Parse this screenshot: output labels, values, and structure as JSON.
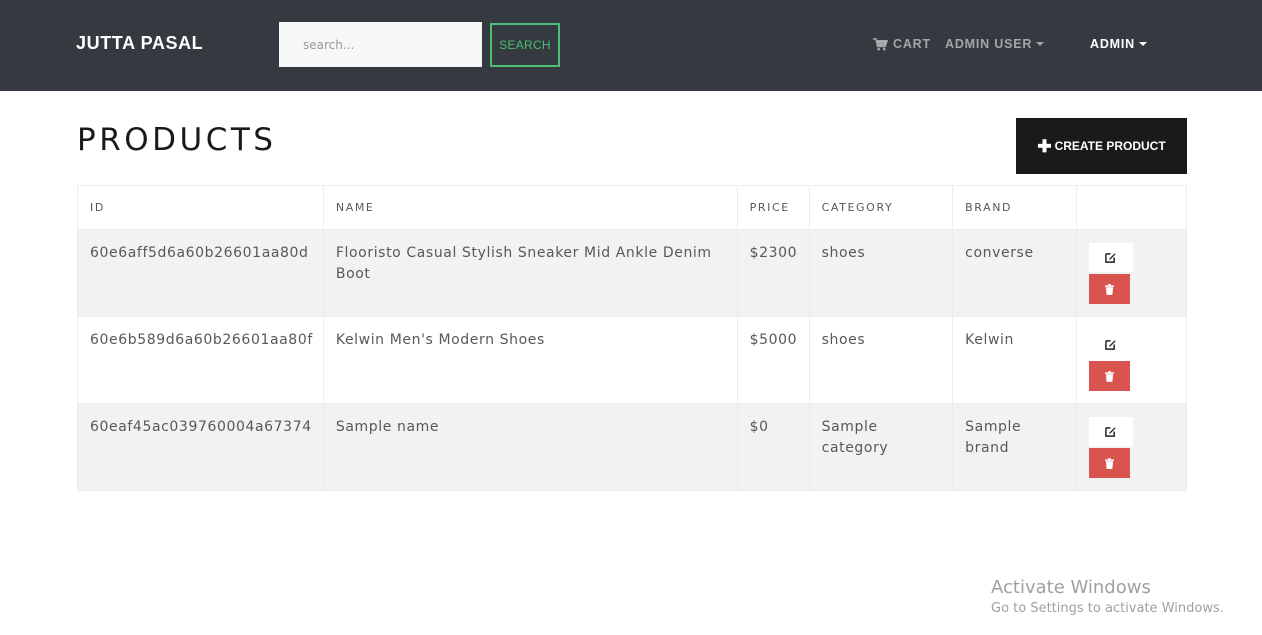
{
  "navbar": {
    "brand": "JUTTA PASAL",
    "search": {
      "placeholder": "search...",
      "value": ""
    },
    "search_button": "SEARCH",
    "cart_label": "CART",
    "admin_user_label": "ADMIN USER",
    "admin_label": "ADMIN"
  },
  "page": {
    "title": "PRODUCTS",
    "create_button": "CREATE PRODUCT"
  },
  "table": {
    "headers": [
      "ID",
      "NAME",
      "PRICE",
      "CATEGORY",
      "BRAND",
      ""
    ],
    "rows": [
      {
        "id": "60e6aff5d6a60b26601aa80d",
        "name": "Flooristo Casual Stylish Sneaker Mid Ankle Denim Boot",
        "price": "$2300",
        "category": "shoes",
        "brand": "converse"
      },
      {
        "id": "60e6b589d6a60b26601aa80f",
        "name": "Kelwin Men's Modern Shoes",
        "price": "$5000",
        "category": "shoes",
        "brand": "Kelwin"
      },
      {
        "id": "60eaf45ac039760004a67374",
        "name": "Sample name",
        "price": "$0",
        "category": "Sample category",
        "brand": "Sample brand"
      }
    ]
  },
  "watermark": {
    "title": "Activate Windows",
    "subtitle": "Go to Settings to activate Windows."
  },
  "colors": {
    "navbar_bg": "#343a40",
    "accent_green": "#4bbf73",
    "danger": "#d9534f",
    "dark_button": "#1a1a1a"
  },
  "icons": {
    "cart": "shopping-cart-icon",
    "plus": "plus-icon",
    "edit": "edit-icon",
    "delete": "trash-icon"
  }
}
